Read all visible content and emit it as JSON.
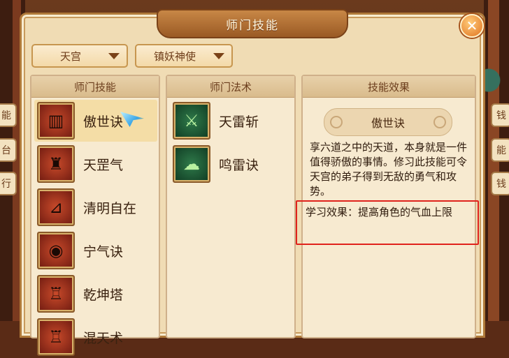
{
  "window": {
    "title": "师门技能",
    "close_label": "✕"
  },
  "filters": {
    "sect": "天宫",
    "master": "镇妖神使"
  },
  "panels": {
    "skills_header": "师门技能",
    "spells_header": "师门法术",
    "effect_header": "技能效果"
  },
  "skills": [
    {
      "name": "傲世诀",
      "icon": "scroll-icon"
    },
    {
      "name": "天罡气",
      "icon": "warrior-icon"
    },
    {
      "name": "清明自在",
      "icon": "signal-icon"
    },
    {
      "name": "宁气诀",
      "icon": "mirror-icon"
    },
    {
      "name": "乾坤塔",
      "icon": "pagoda-icon"
    },
    {
      "name": "混天术",
      "icon": "tower-icon"
    }
  ],
  "spells": [
    {
      "name": "天雷斩",
      "icon": "thunder-sword-icon"
    },
    {
      "name": "鸣雷诀",
      "icon": "cloud-thunder-icon"
    }
  ],
  "effect": {
    "skill_name": "傲世诀",
    "description": "享六道之中的天道，本身就是一件值得骄傲的事情。修习此技能可令天宫的弟子得到无敌的勇气和攻势。",
    "learn_effect": "学习效果：提高角色的气血上限"
  },
  "side_tabs": {
    "left": [
      "能",
      "台",
      "行"
    ],
    "right": [
      "钱",
      "能",
      "钱"
    ]
  }
}
